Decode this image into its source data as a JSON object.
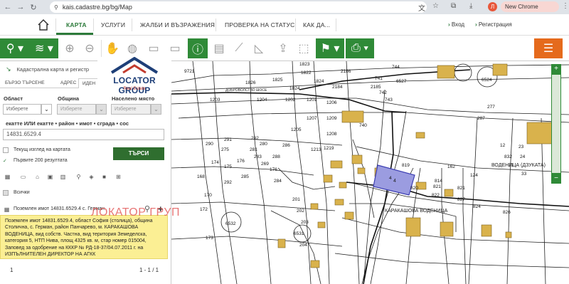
{
  "browser": {
    "url": "kais.cadastre.bg/bg/Map",
    "update_label": "New Chrome available",
    "avatar_letter": "Л"
  },
  "nav": {
    "items": [
      "КАРТА",
      "УСЛУГИ",
      "ЖАЛБИ И ВЪЗРАЖЕНИЯ",
      "ПРОВЕРКА НА СТАТУС",
      "КАК ДА..."
    ],
    "login": "Вход",
    "register": "Регистрация"
  },
  "panel": {
    "title": "Кадастрална карта и регистр",
    "tabs": [
      "БЪРЗО ТЪРСЕНЕ",
      "АДРЕС",
      "ИДЕН"
    ],
    "field_labels": [
      "Област",
      "Община",
      "Населено място"
    ],
    "field_placeholders": [
      "Изберете",
      "Изберете",
      "Изберете"
    ],
    "search_label": "екатте ИЛИ екатте • район • имот • сграда • сос",
    "search_value": "14831.6529.4",
    "checkbox_current_view": "Текущ изглед на картата",
    "checkbox_first_200": "Първите 200 резултата",
    "search_button": "ТЪРСИ",
    "all_label": "Всички",
    "result_title": "Поземлен имот 14831.6529.4 с. Герман",
    "result_lines": [
      "Поземлен имот 14831.6529.4, област София (столица), община",
      "Столична, с. Герман, район Панчарево, м. КАРАКАШОВА",
      "ВОДЕНИЦА, вид собств. Частна, вид територия Земеделска,",
      "категория 5, НТП Нива, площ 4325 кв. м, стар номер 015004,",
      "Заповед за одобрение на КККР № РД-18-37/04.07.2011 г. на",
      "ИЗПЪЛНИТЕЛЕН ДИРЕКТОР НА АГКК"
    ],
    "page_number": "1",
    "page_count": "1 - 1 / 1"
  },
  "brand": {
    "name": "LOCATOR GROUP",
    "sub": "Real Estate",
    "watermark": "ЛОКАТОР ГРУП"
  },
  "map": {
    "labels": [
      "9721",
      "1825",
      "1826",
      "1824",
      "1823",
      "1822",
      "1824",
      "1204",
      "1203",
      "1202",
      "1201",
      "1205",
      "1207",
      "1209",
      "1206",
      "1208",
      "1213",
      "1219",
      "176",
      "2184",
      "2186",
      "2185",
      "740",
      "741",
      "742",
      "743",
      "744",
      "6527",
      "6524",
      "277",
      "287",
      "280",
      "288",
      "286",
      "269",
      "819",
      "820",
      "814",
      "822",
      "821",
      "827",
      "824",
      "826",
      "821",
      "832",
      "4",
      "6531",
      "6532",
      "124",
      "162",
      "12",
      "23",
      "24",
      "31",
      "33",
      "275",
      "174",
      "175",
      "176",
      "168",
      "283",
      "285",
      "290",
      "291",
      "292",
      "281",
      "282",
      "284",
      "201",
      "202",
      "203",
      "204",
      "170",
      "172",
      "173"
    ],
    "place_label_1": "КАРАКАШОВА ВОДЕНИЦА",
    "place_label_2": "ВОДЕНИЦА (ДЗУКАТА)",
    "place_label_3": "ДОБРОВОЛСТВО ШОСЕ",
    "highlight_label": "4"
  }
}
